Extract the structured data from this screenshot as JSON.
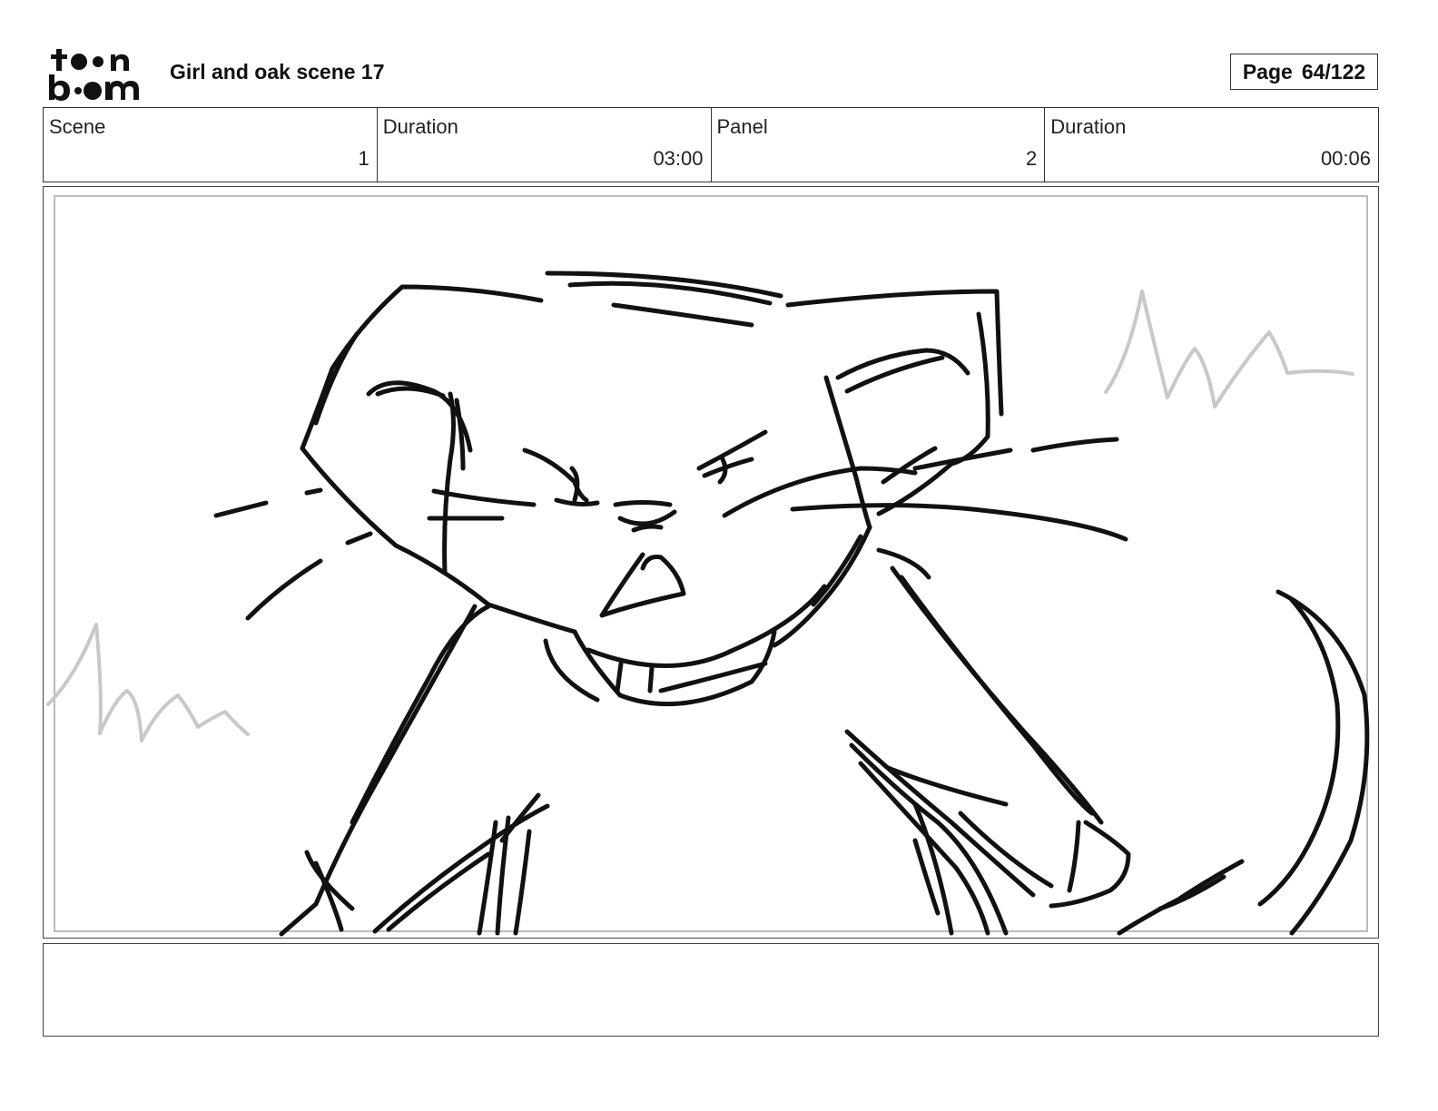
{
  "header": {
    "logo_text": "toon boom",
    "title": "Girl and oak scene 17",
    "page_label": "Page",
    "page_value": "64/122"
  },
  "info": {
    "scene_label": "Scene",
    "scene_value": "1",
    "scene_duration_label": "Duration",
    "scene_duration_value": "03:00",
    "panel_label": "Panel",
    "panel_value": "2",
    "panel_duration_label": "Duration",
    "panel_duration_value": "00:06"
  },
  "panel": {
    "image": "rough storyboard sketch of a cat face and body"
  },
  "notes": {
    "text": ""
  }
}
